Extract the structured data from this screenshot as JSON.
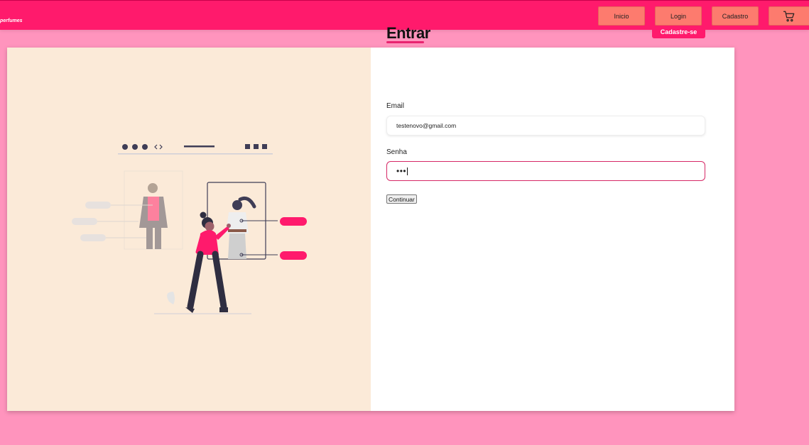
{
  "app": {
    "brand": "perfumes"
  },
  "nav": {
    "items": [
      {
        "label": "Inicio"
      },
      {
        "label": "Login"
      },
      {
        "label": "Cadastro"
      }
    ],
    "cart_icon": "shopping-cart-icon"
  },
  "login": {
    "title": "Entrar",
    "signup_label": "Cadastre-se",
    "email_label": "Email",
    "email_value": "testenovo@gmail.com",
    "senha_label": "Senha",
    "senha_value": "•••",
    "continue_label": "Continuar"
  },
  "colors": {
    "page_bg": "#ff94bd",
    "topbar": "#ff1a6c",
    "nav_button": "#fd7b6e",
    "accent": "#ff1a6c",
    "illustration_bg": "#fbead8"
  }
}
